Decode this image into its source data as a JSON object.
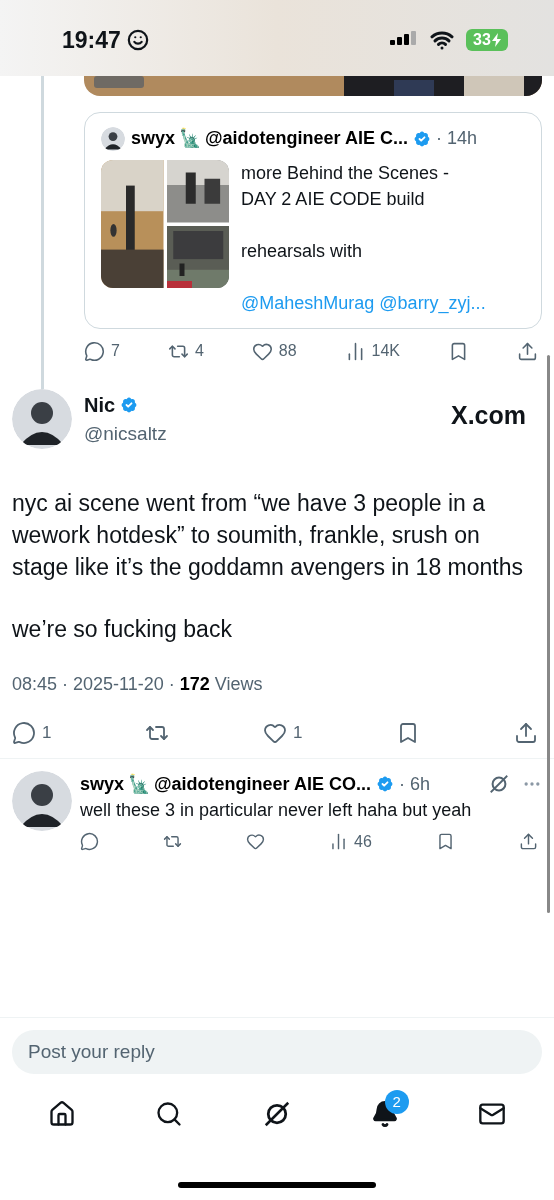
{
  "status_bar": {
    "time": "19:47",
    "battery": "33"
  },
  "quoted_post": {
    "author": "swyx",
    "emoji": "🗽",
    "handle": "@aidotengineer AIE C...",
    "verified": true,
    "time": "· 14h",
    "paragraphs": [
      "more Behind the Scenes -\nDAY 2 AIE CODE build",
      "rehearsals with"
    ],
    "mentions": "@MaheshMurag @barry_zyj..."
  },
  "parent_actions": [
    {
      "kind": "reply",
      "count": "7"
    },
    {
      "kind": "repost",
      "count": "4"
    },
    {
      "kind": "like",
      "count": "88",
      "liked": false
    },
    {
      "kind": "views",
      "count": "14K"
    },
    {
      "kind": "bookmark"
    },
    {
      "kind": "share"
    }
  ],
  "post": {
    "name": "Nic",
    "verified": true,
    "handle": "@nicsaltz",
    "source": "X.com",
    "paragraphs": [
      "nyc ai scene went from “we have 3 people in a wework hotdesk” to soumith, frankle, srush on stage like it’s the goddamn avengers in 18 months",
      "we’re so fucking back"
    ],
    "meta": "08:45 · 2025-11-20 · **172** Views"
  },
  "post_actions": [
    {
      "kind": "reply",
      "count": "1"
    },
    {
      "kind": "repost"
    },
    {
      "kind": "like",
      "count": "1",
      "liked": false
    },
    {
      "kind": "bookmark"
    },
    {
      "kind": "share"
    }
  ],
  "reply": {
    "author": "swyx",
    "emoji": "🗽",
    "handle": "@aidotengineer AIE CO...",
    "verified": true,
    "time": "· 6h",
    "text": "well these 3 in particular never left haha but yeah"
  },
  "reply_actions": [
    {
      "kind": "reply"
    },
    {
      "kind": "repost"
    },
    {
      "kind": "like",
      "liked": false
    },
    {
      "kind": "views",
      "count": "46"
    },
    {
      "kind": "bookmark"
    },
    {
      "kind": "share"
    }
  ],
  "reply_field": {
    "placeholder": "Post your reply"
  },
  "tab_bar": [
    {
      "kind": "home",
      "selected": false
    },
    {
      "kind": "search",
      "selected": false
    },
    {
      "kind": "grok",
      "selected": false
    },
    {
      "kind": "notifications",
      "selected": true,
      "badge": "2"
    },
    {
      "kind": "messages",
      "selected": false
    }
  ]
}
